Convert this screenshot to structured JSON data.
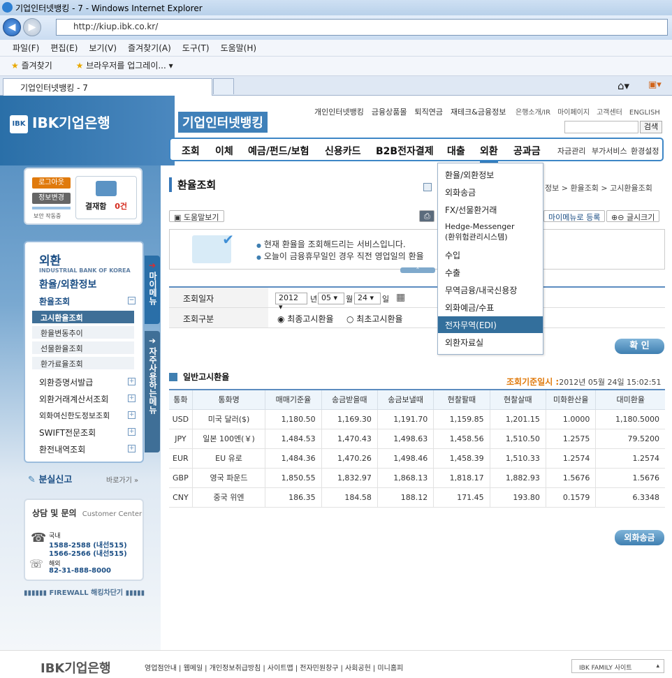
{
  "browser": {
    "window_title": "기업인터넷뱅킹 - 7 - Windows Internet Explorer",
    "url": "http://kiup.ibk.co.kr/",
    "menus": [
      "파일(F)",
      "편집(E)",
      "보기(V)",
      "즐겨찾기(A)",
      "도구(T)",
      "도움말(H)"
    ],
    "favorites_label": "즐겨찾기",
    "fav_item": "브라우저를 업그레이...",
    "tab_title": "기업인터넷뱅킹 - 7"
  },
  "header": {
    "logo_text": "IBK기업은행",
    "logo_badge": "IBK",
    "site_title": "기업인터넷뱅킹",
    "top_links": [
      "개인인터넷뱅킹",
      "금융상품몰",
      "퇴직연금",
      "재테크&금융정보"
    ],
    "util_links": [
      "은행소개/IR",
      "마이페이지",
      "고객센터",
      "ENGLISH"
    ],
    "search_button": "검색",
    "gnb_main": [
      "조회",
      "이체",
      "예금/펀드/보험",
      "신용카드",
      "B2B전자결제",
      "대출",
      "외환",
      "공과금"
    ],
    "gnb_sub": [
      "자금관리",
      "부가서비스",
      "환경설정"
    ]
  },
  "login_box": {
    "logout": "로그아웃",
    "info_change": "정보변경",
    "security": "보안 작동중",
    "approval_label": "결재함",
    "approval_count": "0건"
  },
  "left_menu": {
    "title": "외환",
    "eng": "INDUSTRIAL BANK OF KOREA",
    "subtitle": "환율/외환정보",
    "rate_lookup": "환율조회",
    "sub_items": [
      "고시환율조회",
      "환율변동추이",
      "선물환율조회",
      "환가료율조회"
    ],
    "items": [
      "외환증명서발급",
      "외환거래계산서조회",
      "외화여신한도정보조회",
      "SWIFT전문조회",
      "환전내역조회"
    ],
    "my_menu_tab": "마이메뉴",
    "freq_menu_tab": "자주사용하는메뉴",
    "lost_report": "분실신고",
    "shortcut": "바로가기 »",
    "cs_title": "상담 및 문의",
    "cs_eng": "Customer Center",
    "cs_domestic": "국내",
    "cs_phone1": "1588-2588 (내선515)",
    "cs_phone2": "1566-2566 (내선515)",
    "cs_overseas": "해외",
    "cs_phone3": "82-31-888-8000",
    "firewall": "FIREWALL 해킹차단기"
  },
  "content": {
    "title": "환율조회",
    "breadcrumb_tail": "정보 > 환율조회 > 고시환율조회",
    "help_btn": "도움말보기",
    "mymenu_btn": "마이메뉴로 등록",
    "fontsize_btn": "글시크기",
    "info_line1": "현재 환율을 조회해드리는 서비스입니다.",
    "info_line2": "오늘이 금융휴무일인 경우 직전 영업일의 환율",
    "form": {
      "date_label": "조회일자",
      "year": "2012",
      "year_unit": "년",
      "month": "05",
      "month_unit": "월",
      "day": "24",
      "day_unit": "일",
      "type_label": "조회구분",
      "opt_final": "최종고시환율",
      "opt_first": "최초고시환율"
    },
    "confirm_btn": "확 인",
    "general_title": "일반고시환율",
    "std_time_label": "조회기준일시 :",
    "std_time_value": "2012년 05월 24일 15:02:51",
    "table": {
      "headers": [
        "통화",
        "통화명",
        "매매기준율",
        "송금받을때",
        "송금보낼때",
        "현찰팔때",
        "현찰살때",
        "미화환산율",
        "대미환율"
      ],
      "rows": [
        [
          "USD",
          "미국 달러($)",
          "1,180.50",
          "1,169.30",
          "1,191.70",
          "1,159.85",
          "1,201.15",
          "1.0000",
          "1,180.5000"
        ],
        [
          "JPY",
          "일본 100엔(￥)",
          "1,484.53",
          "1,470.43",
          "1,498.63",
          "1,458.56",
          "1,510.50",
          "1.2575",
          "79.5200"
        ],
        [
          "EUR",
          "EU 유로",
          "1,484.36",
          "1,470.26",
          "1,498.46",
          "1,458.39",
          "1,510.33",
          "1.2574",
          "1.2574"
        ],
        [
          "GBP",
          "영국 파운드",
          "1,850.55",
          "1,832.97",
          "1,868.13",
          "1,818.17",
          "1,882.93",
          "1.5676",
          "1.5676"
        ],
        [
          "CNY",
          "중국 위엔",
          "186.35",
          "184.58",
          "188.12",
          "171.45",
          "193.80",
          "0.1579",
          "6.3348"
        ]
      ]
    },
    "fx_send_btn": "외화송금"
  },
  "dropdown": {
    "items": [
      "환율/외환정보",
      "외화송금",
      "FX/선물환거래",
      "Hedge-Messenger",
      "(환위험관리시스템)",
      "수입",
      "수출",
      "무역금융/내국신용장",
      "외화예금/수표",
      "전자무역(EDI)",
      "외환자료실"
    ]
  },
  "footer": {
    "logo": "IBK기업은행",
    "links": [
      "영업점안내",
      "웹메일",
      "개인정보취급방침",
      "사이트맵",
      "전자민원창구",
      "사회공헌",
      "미니홈피"
    ],
    "family": "IBK FAMILY 사이트"
  },
  "colors": {
    "brand": "#2a6fa8",
    "accent": "#e07a0c",
    "dropdown_active": "#336f9c"
  }
}
